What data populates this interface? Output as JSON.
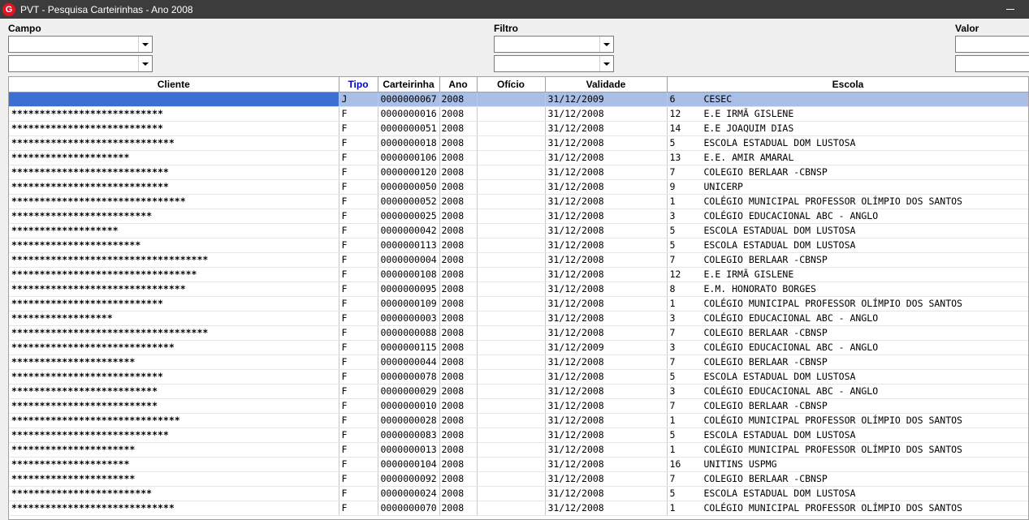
{
  "window": {
    "title": "PVT - Pesquisa Carteirinhas - Ano 2008",
    "icon_letter": "G"
  },
  "filters": {
    "campo_label": "Campo",
    "filtro_label": "Filtro",
    "valor_label": "Valor",
    "campo1": "",
    "campo2": "",
    "filtro1": "",
    "filtro2": "",
    "valor1": "",
    "valor2": ""
  },
  "table": {
    "headers": {
      "cliente": "Cliente",
      "tipo": "Tipo",
      "carteirinha": "Carteirinha",
      "ano": "Ano",
      "oficio": "Ofício",
      "validade": "Validade",
      "escola": "Escola"
    },
    "rows": [
      {
        "cliente": "",
        "tipo": "J",
        "carteirinha": "0000000067",
        "ano": "2008",
        "oficio": "",
        "validade": "31/12/2009",
        "esc_code": "6",
        "escola": "CESEC"
      },
      {
        "cliente": "***************************",
        "tipo": "F",
        "carteirinha": "0000000016",
        "ano": "2008",
        "oficio": "",
        "validade": "31/12/2008",
        "esc_code": "12",
        "escola": "E.E IRMÃ GISLENE"
      },
      {
        "cliente": "***************************",
        "tipo": "F",
        "carteirinha": "0000000051",
        "ano": "2008",
        "oficio": "",
        "validade": "31/12/2008",
        "esc_code": "14",
        "escola": "E.E JOAQUIM DIAS"
      },
      {
        "cliente": "*****************************",
        "tipo": "F",
        "carteirinha": "0000000018",
        "ano": "2008",
        "oficio": "",
        "validade": "31/12/2008",
        "esc_code": "5",
        "escola": "ESCOLA ESTADUAL DOM LUSTOSA"
      },
      {
        "cliente": "*********************",
        "tipo": "F",
        "carteirinha": "0000000106",
        "ano": "2008",
        "oficio": "",
        "validade": "31/12/2008",
        "esc_code": "13",
        "escola": "E.E. AMIR AMARAL"
      },
      {
        "cliente": "****************************",
        "tipo": "F",
        "carteirinha": "0000000120",
        "ano": "2008",
        "oficio": "",
        "validade": "31/12/2008",
        "esc_code": "7",
        "escola": "COLEGIO BERLAAR -CBNSP"
      },
      {
        "cliente": "****************************",
        "tipo": "F",
        "carteirinha": "0000000050",
        "ano": "2008",
        "oficio": "",
        "validade": "31/12/2008",
        "esc_code": "9",
        "escola": "UNICERP"
      },
      {
        "cliente": "*******************************",
        "tipo": "F",
        "carteirinha": "0000000052",
        "ano": "2008",
        "oficio": "",
        "validade": "31/12/2008",
        "esc_code": "1",
        "escola": "COLÉGIO MUNICIPAL PROFESSOR OLÍMPIO DOS SANTOS"
      },
      {
        "cliente": "*************************",
        "tipo": "F",
        "carteirinha": "0000000025",
        "ano": "2008",
        "oficio": "",
        "validade": "31/12/2008",
        "esc_code": "3",
        "escola": "COLÉGIO EDUCACIONAL ABC - ANGLO"
      },
      {
        "cliente": "*******************",
        "tipo": "F",
        "carteirinha": "0000000042",
        "ano": "2008",
        "oficio": "",
        "validade": "31/12/2008",
        "esc_code": "5",
        "escola": "ESCOLA ESTADUAL DOM LUSTOSA"
      },
      {
        "cliente": "***********************",
        "tipo": "F",
        "carteirinha": "0000000113",
        "ano": "2008",
        "oficio": "",
        "validade": "31/12/2008",
        "esc_code": "5",
        "escola": "ESCOLA ESTADUAL DOM LUSTOSA"
      },
      {
        "cliente": "***********************************",
        "tipo": "F",
        "carteirinha": "0000000004",
        "ano": "2008",
        "oficio": "",
        "validade": "31/12/2008",
        "esc_code": "7",
        "escola": "COLEGIO BERLAAR -CBNSP"
      },
      {
        "cliente": "*********************************",
        "tipo": "F",
        "carteirinha": "0000000108",
        "ano": "2008",
        "oficio": "",
        "validade": "31/12/2008",
        "esc_code": "12",
        "escola": "E.E IRMÃ GISLENE"
      },
      {
        "cliente": "*******************************",
        "tipo": "F",
        "carteirinha": "0000000095",
        "ano": "2008",
        "oficio": "",
        "validade": "31/12/2008",
        "esc_code": "8",
        "escola": "E.M. HONORATO BORGES"
      },
      {
        "cliente": "***************************",
        "tipo": "F",
        "carteirinha": "0000000109",
        "ano": "2008",
        "oficio": "",
        "validade": "31/12/2008",
        "esc_code": "1",
        "escola": "COLÉGIO MUNICIPAL PROFESSOR OLÍMPIO DOS SANTOS"
      },
      {
        "cliente": "******************",
        "tipo": "F",
        "carteirinha": "0000000003",
        "ano": "2008",
        "oficio": "",
        "validade": "31/12/2008",
        "esc_code": "3",
        "escola": "COLÉGIO EDUCACIONAL ABC - ANGLO"
      },
      {
        "cliente": "***********************************",
        "tipo": "F",
        "carteirinha": "0000000088",
        "ano": "2008",
        "oficio": "",
        "validade": "31/12/2008",
        "esc_code": "7",
        "escola": "COLEGIO BERLAAR -CBNSP"
      },
      {
        "cliente": "*****************************",
        "tipo": "F",
        "carteirinha": "0000000115",
        "ano": "2008",
        "oficio": "",
        "validade": "31/12/2009",
        "esc_code": "3",
        "escola": "COLÉGIO EDUCACIONAL ABC - ANGLO"
      },
      {
        "cliente": "**********************",
        "tipo": "F",
        "carteirinha": "0000000044",
        "ano": "2008",
        "oficio": "",
        "validade": "31/12/2008",
        "esc_code": "7",
        "escola": "COLEGIO BERLAAR -CBNSP"
      },
      {
        "cliente": "***************************",
        "tipo": "F",
        "carteirinha": "0000000078",
        "ano": "2008",
        "oficio": "",
        "validade": "31/12/2008",
        "esc_code": "5",
        "escola": "ESCOLA ESTADUAL DOM LUSTOSA"
      },
      {
        "cliente": "**************************",
        "tipo": "F",
        "carteirinha": "0000000029",
        "ano": "2008",
        "oficio": "",
        "validade": "31/12/2008",
        "esc_code": "3",
        "escola": "COLÉGIO EDUCACIONAL ABC - ANGLO"
      },
      {
        "cliente": "**************************",
        "tipo": "F",
        "carteirinha": "0000000010",
        "ano": "2008",
        "oficio": "",
        "validade": "31/12/2008",
        "esc_code": "7",
        "escola": "COLEGIO BERLAAR -CBNSP"
      },
      {
        "cliente": "******************************",
        "tipo": "F",
        "carteirinha": "0000000028",
        "ano": "2008",
        "oficio": "",
        "validade": "31/12/2008",
        "esc_code": "1",
        "escola": "COLÉGIO MUNICIPAL PROFESSOR OLÍMPIO DOS SANTOS"
      },
      {
        "cliente": "****************************",
        "tipo": "F",
        "carteirinha": "0000000083",
        "ano": "2008",
        "oficio": "",
        "validade": "31/12/2008",
        "esc_code": "5",
        "escola": "ESCOLA ESTADUAL DOM LUSTOSA"
      },
      {
        "cliente": "**********************",
        "tipo": "F",
        "carteirinha": "0000000013",
        "ano": "2008",
        "oficio": "",
        "validade": "31/12/2008",
        "esc_code": "1",
        "escola": "COLÉGIO MUNICIPAL PROFESSOR OLÍMPIO DOS SANTOS"
      },
      {
        "cliente": "*********************",
        "tipo": "F",
        "carteirinha": "0000000104",
        "ano": "2008",
        "oficio": "",
        "validade": "31/12/2008",
        "esc_code": "16",
        "escola": "UNITINS USPMG"
      },
      {
        "cliente": "**********************",
        "tipo": "F",
        "carteirinha": "0000000092",
        "ano": "2008",
        "oficio": "",
        "validade": "31/12/2008",
        "esc_code": "7",
        "escola": "COLEGIO BERLAAR -CBNSP"
      },
      {
        "cliente": "*************************",
        "tipo": "F",
        "carteirinha": "0000000024",
        "ano": "2008",
        "oficio": "",
        "validade": "31/12/2008",
        "esc_code": "5",
        "escola": "ESCOLA ESTADUAL DOM LUSTOSA"
      },
      {
        "cliente": "*****************************",
        "tipo": "F",
        "carteirinha": "0000000070",
        "ano": "2008",
        "oficio": "",
        "validade": "31/12/2008",
        "esc_code": "1",
        "escola": "COLÉGIO MUNICIPAL PROFESSOR OLÍMPIO DOS SANTOS"
      }
    ]
  }
}
